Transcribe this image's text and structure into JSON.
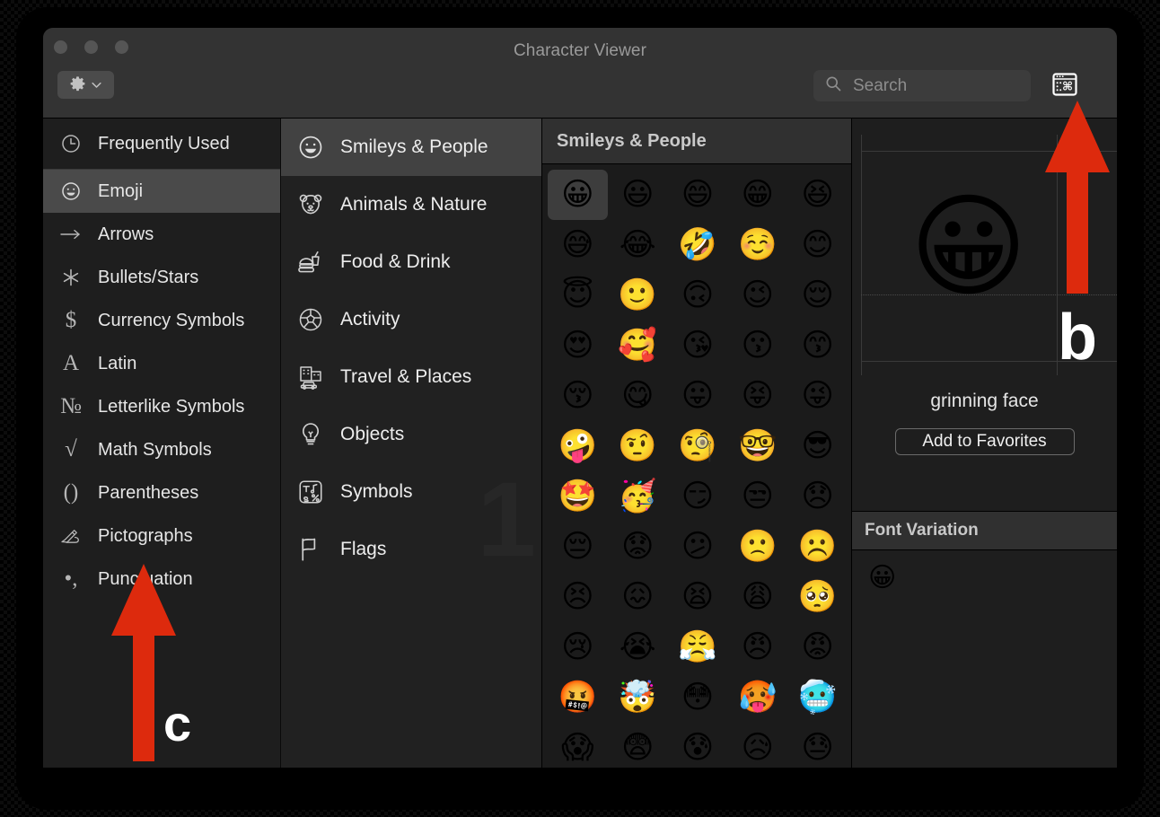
{
  "window": {
    "title": "Character Viewer",
    "traffic_lights": [
      "close",
      "minimize",
      "zoom"
    ],
    "gear_button_label": "gear-menu",
    "character_viewer_toggle_label": "character-viewer-toggle"
  },
  "search": {
    "placeholder": "Search",
    "value": ""
  },
  "sidebar": {
    "items": [
      {
        "label": "Frequently Used",
        "icon": "clock-icon",
        "glyph": "◴",
        "selected": false
      },
      {
        "label": "Emoji",
        "icon": "smiley-icon",
        "glyph": "☺",
        "selected": true
      },
      {
        "label": "Arrows",
        "icon": "arrow-icon",
        "glyph": "⟶",
        "selected": false
      },
      {
        "label": "Bullets/Stars",
        "icon": "asterisk-icon",
        "glyph": "✳",
        "selected": false
      },
      {
        "label": "Currency Symbols",
        "icon": "dollar-icon",
        "glyph": "$",
        "selected": false
      },
      {
        "label": "Latin",
        "icon": "letter-a-icon",
        "glyph": "A",
        "selected": false
      },
      {
        "label": "Letterlike Symbols",
        "icon": "numero-icon",
        "glyph": "№",
        "selected": false
      },
      {
        "label": "Math Symbols",
        "icon": "radical-icon",
        "glyph": "√",
        "selected": false
      },
      {
        "label": "Parentheses",
        "icon": "parentheses-icon",
        "glyph": "()",
        "selected": false
      },
      {
        "label": "Pictographs",
        "icon": "writing-hand-icon",
        "glyph": "✍",
        "selected": false
      },
      {
        "label": "Punctuation",
        "icon": "punctuation-icon",
        "glyph": "•,",
        "selected": false
      }
    ]
  },
  "categories": {
    "watermark": "1",
    "items": [
      {
        "label": "Smileys & People",
        "icon": "smiley-face-icon",
        "selected": true
      },
      {
        "label": "Animals & Nature",
        "icon": "bear-face-icon",
        "selected": false
      },
      {
        "label": "Food & Drink",
        "icon": "burger-drink-icon",
        "selected": false
      },
      {
        "label": "Activity",
        "icon": "soccer-ball-icon",
        "selected": false
      },
      {
        "label": "Travel & Places",
        "icon": "car-building-icon",
        "selected": false
      },
      {
        "label": "Objects",
        "icon": "lightbulb-icon",
        "selected": false
      },
      {
        "label": "Symbols",
        "icon": "symbols-box-icon",
        "selected": false
      },
      {
        "label": "Flags",
        "icon": "flag-icon",
        "selected": false
      }
    ]
  },
  "grid": {
    "header": "Smileys & People",
    "selected_index": 0,
    "emojis": [
      "😀",
      "😃",
      "😄",
      "😁",
      "😆",
      "😅",
      "😂",
      "🤣",
      "☺️",
      "😊",
      "😇",
      "🙂",
      "🙃",
      "😉",
      "😌",
      "😍",
      "🥰",
      "😘",
      "😗",
      "😙",
      "😚",
      "😋",
      "😛",
      "😝",
      "😜",
      "🤪",
      "🤨",
      "🧐",
      "🤓",
      "😎",
      "🤩",
      "🥳",
      "😏",
      "😒",
      "😞",
      "😔",
      "😟",
      "😕",
      "🙁",
      "☹️",
      "😣",
      "😖",
      "😫",
      "😩",
      "🥺",
      "😢",
      "😭",
      "😤",
      "😠",
      "😡",
      "🤬",
      "🤯",
      "😳",
      "🥵",
      "🥶",
      "😱",
      "😨",
      "😰",
      "😥",
      "😓"
    ]
  },
  "preview": {
    "emoji": "😀",
    "character_name": "grinning face",
    "add_to_favorites_label": "Add to Favorites"
  },
  "font_variation": {
    "header": "Font Variation",
    "items": [
      "😀"
    ]
  },
  "annotations": {
    "color": "#dd2a0d",
    "markers": [
      {
        "letter": "b",
        "points_to": "character-viewer-toggle"
      },
      {
        "letter": "c",
        "points_to": "sidebar-list"
      }
    ]
  }
}
